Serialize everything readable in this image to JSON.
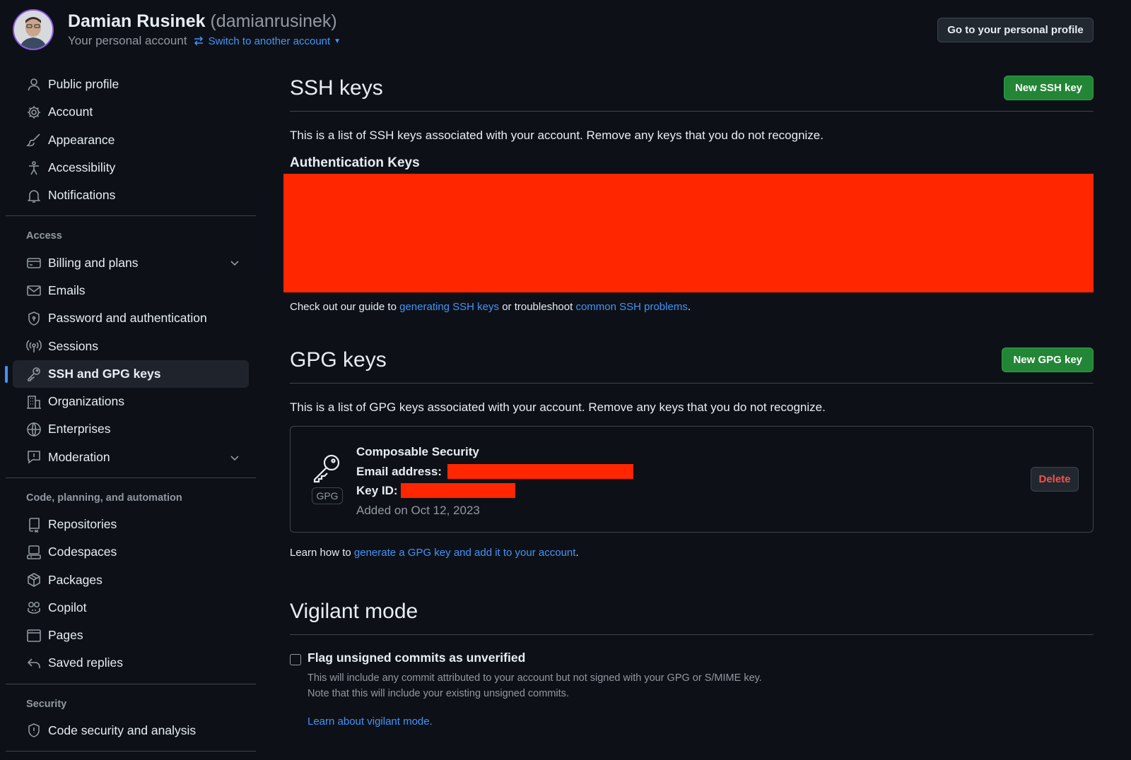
{
  "header": {
    "name": "Damian Rusinek",
    "handle": "(damianrusinek)",
    "subtitle": "Your personal account",
    "switch_label": "Switch to another account",
    "profile_button": "Go to your personal profile"
  },
  "sidebar": {
    "group1": [
      {
        "label": "Public profile",
        "icon": "person-icon"
      },
      {
        "label": "Account",
        "icon": "gear-icon"
      },
      {
        "label": "Appearance",
        "icon": "paintbrush-icon"
      },
      {
        "label": "Accessibility",
        "icon": "accessibility-icon"
      },
      {
        "label": "Notifications",
        "icon": "bell-icon"
      }
    ],
    "access_heading": "Access",
    "group2": [
      {
        "label": "Billing and plans",
        "icon": "credit-card-icon"
      },
      {
        "label": "Emails",
        "icon": "mail-icon"
      },
      {
        "label": "Password and authentication",
        "icon": "shield-lock-icon"
      },
      {
        "label": "Sessions",
        "icon": "broadcast-icon"
      },
      {
        "label": "SSH and GPG keys",
        "icon": "key-icon"
      },
      {
        "label": "Organizations",
        "icon": "organization-icon"
      },
      {
        "label": "Enterprises",
        "icon": "globe-icon"
      },
      {
        "label": "Moderation",
        "icon": "report-icon"
      }
    ],
    "code_heading": "Code, planning, and automation",
    "group3": [
      {
        "label": "Repositories",
        "icon": "repo-icon"
      },
      {
        "label": "Codespaces",
        "icon": "codespaces-icon"
      },
      {
        "label": "Packages",
        "icon": "package-icon"
      },
      {
        "label": "Copilot",
        "icon": "copilot-icon"
      },
      {
        "label": "Pages",
        "icon": "browser-icon"
      },
      {
        "label": "Saved replies",
        "icon": "reply-icon"
      }
    ],
    "security_heading": "Security",
    "group4": [
      {
        "label": "Code security and analysis",
        "icon": "shield-icon"
      }
    ]
  },
  "ssh": {
    "title": "SSH keys",
    "new_button": "New SSH key",
    "description": "This is a list of SSH keys associated with your account. Remove any keys that you do not recognize.",
    "auth_title": "Authentication Keys",
    "guide_prefix": "Check out our guide to ",
    "guide_link1": "generating SSH keys",
    "guide_middle": " or troubleshoot ",
    "guide_link2": "common SSH problems",
    "guide_suffix": "."
  },
  "gpg": {
    "title": "GPG keys",
    "new_button": "New GPG key",
    "description": "This is a list of GPG keys associated with your account. Remove any keys that you do not recognize.",
    "key": {
      "name": "Composable Security",
      "email_label": "Email address:",
      "keyid_label": "Key ID:",
      "added": "Added on Oct 12, 2023",
      "badge": "GPG",
      "delete_button": "Delete"
    },
    "learn_prefix": "Learn how to ",
    "learn_link": "generate a GPG key and add it to your account",
    "learn_suffix": "."
  },
  "vigilant": {
    "title": "Vigilant mode",
    "checkbox_label": "Flag unsigned commits as unverified",
    "desc_line1": "This will include any commit attributed to your account but not signed with your GPG or S/MIME key.",
    "desc_line2": "Note that this will include your existing unsigned commits.",
    "link": "Learn about vigilant mode.",
    "checked": false
  },
  "colors": {
    "background": "#0d1117",
    "accent": "#4493f8",
    "green_button": "#238636",
    "danger": "#f85149",
    "redaction": "#ff2600"
  }
}
